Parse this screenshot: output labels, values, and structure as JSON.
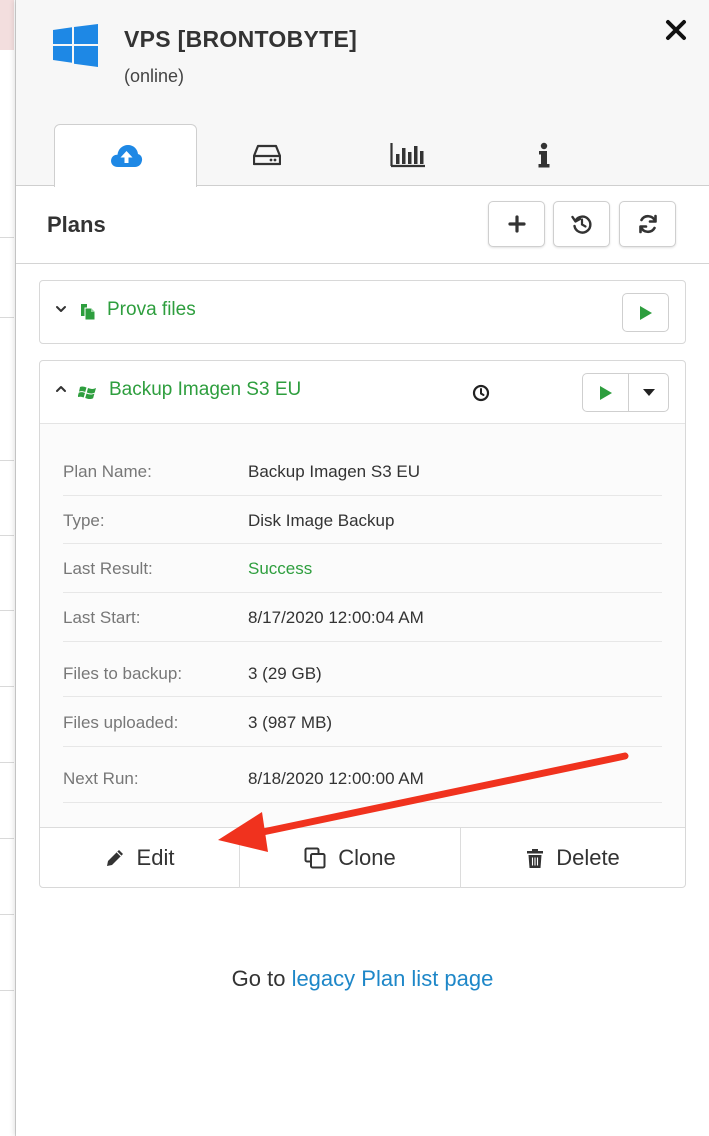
{
  "window": {
    "title": "VPS [BRONTOBYTE]",
    "status": "(online)",
    "close_glyph": "✕"
  },
  "tabs": [
    {
      "icon": "cloud-upload-icon",
      "active": true
    },
    {
      "icon": "hard-drive-icon",
      "active": false
    },
    {
      "icon": "bar-chart-icon",
      "active": false
    },
    {
      "icon": "info-icon",
      "active": false
    }
  ],
  "plans": {
    "heading": "Plans",
    "toolbar": [
      "plus-icon",
      "history-icon",
      "refresh-icon"
    ],
    "items": [
      {
        "name": "Prova files",
        "icon": "files-icon",
        "expanded": false
      },
      {
        "name": "Backup Imagen S3 EU",
        "icon": "windows-icon",
        "expanded": true,
        "scheduled_icon": "clock-icon",
        "details": [
          {
            "label": "Plan Name:",
            "value": "Backup Imagen S3 EU"
          },
          {
            "label": "Type:",
            "value": "Disk Image Backup"
          },
          {
            "label": "Last Result:",
            "value": "Success"
          },
          {
            "label": "Last Start:",
            "value": "8/17/2020 12:00:04 AM"
          },
          {
            "label": "Files to backup:",
            "value": "3 (29 GB)"
          },
          {
            "label": "Files uploaded:",
            "value": "3 (987 MB)"
          },
          {
            "label": "Next Run:",
            "value": "8/18/2020 12:00:00 AM"
          }
        ],
        "actions": [
          {
            "label": "Edit",
            "icon": "pencil-icon"
          },
          {
            "label": "Clone",
            "icon": "clone-icon"
          },
          {
            "label": "Delete",
            "icon": "trash-icon"
          }
        ]
      }
    ]
  },
  "footer": {
    "prefix": "Go to ",
    "link": "legacy Plan list page"
  },
  "colors": {
    "accent_green": "#2e9e3e",
    "link_blue": "#1e87c8",
    "annotation_red": "#f0321e",
    "windows_blue": "#1e88e5"
  }
}
